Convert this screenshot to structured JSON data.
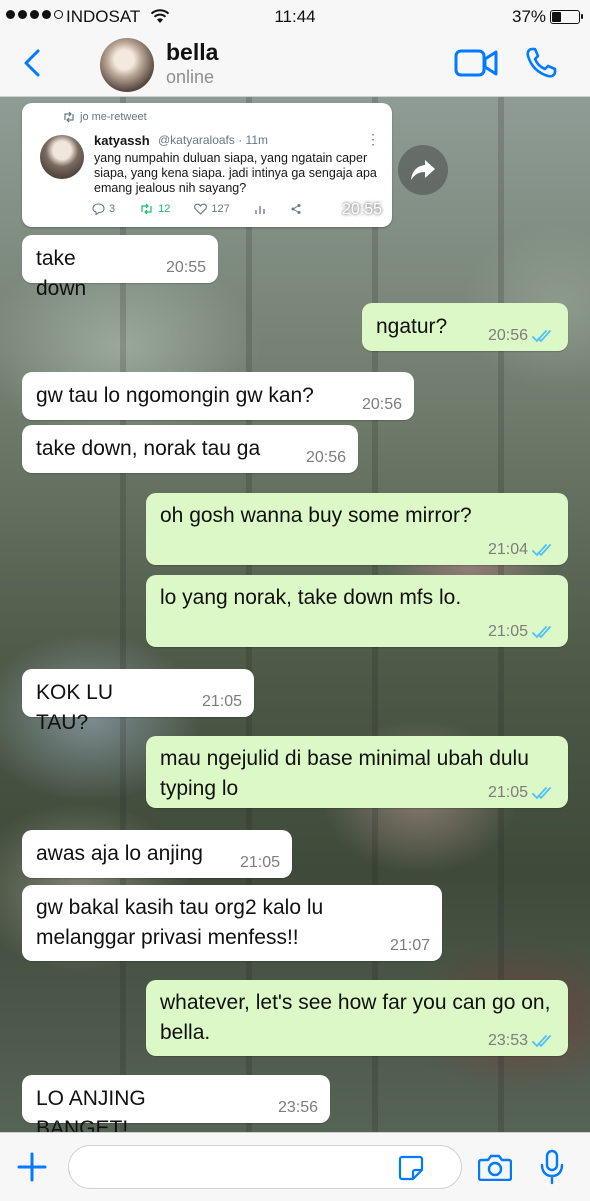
{
  "status_bar": {
    "carrier": "INDOSAT",
    "time": "11:44",
    "battery_pct": "37%",
    "battery_level": 0.37,
    "signal_bars": 4
  },
  "header": {
    "contact_name": "bella",
    "contact_status": "online"
  },
  "tweet": {
    "retweet_line": "jo me-retweet",
    "name": "katyassh",
    "handle": "@katyaraloafs · 11m",
    "body": "yang numpahin duluan siapa, yang ngatain caper siapa, yang kena siapa. jadi intinya ga sengaja apa emang jealous nih sayang?",
    "replies": "3",
    "retweets": "12",
    "likes": "127",
    "time": "20:55"
  },
  "messages": [
    {
      "dir": "in",
      "text": "take down",
      "time": "20:55"
    },
    {
      "dir": "out",
      "text": "ngatur?",
      "time": "20:56"
    },
    {
      "dir": "in",
      "text": "gw tau lo ngomongin gw kan?",
      "time": "20:56"
    },
    {
      "dir": "in",
      "text": "take down, norak tau ga",
      "time": "20:56"
    },
    {
      "dir": "out",
      "text": "oh gosh wanna buy some mirror?",
      "time": "21:04"
    },
    {
      "dir": "out",
      "text": "lo yang norak, take down mfs lo.",
      "time": "21:05"
    },
    {
      "dir": "in",
      "text": "KOK LU TAU?",
      "time": "21:05"
    },
    {
      "dir": "out",
      "text": "mau ngejulid di base minimal ubah dulu typing lo",
      "time": "21:05"
    },
    {
      "dir": "in",
      "text": "awas aja lo anjing",
      "time": "21:05"
    },
    {
      "dir": "in",
      "text": "gw bakal kasih tau org2 kalo lu melanggar privasi menfess!!",
      "time": "21:07"
    },
    {
      "dir": "out",
      "text": "whatever, let's see how far you can go on, bella.",
      "time": "23:53"
    },
    {
      "dir": "in",
      "text": "LO ANJING BANGET!",
      "time": "23:56"
    }
  ],
  "input": {
    "placeholder": "",
    "value": ""
  },
  "colors": {
    "accent": "#007aff",
    "outgoing_bubble": "#dcf8c6",
    "incoming_bubble": "#ffffff",
    "read_ticks": "#4fc3f7"
  },
  "icons": [
    "back-icon",
    "video-call-icon",
    "phone-call-icon",
    "forward-icon",
    "plus-icon",
    "sticker-icon",
    "camera-icon",
    "mic-icon"
  ]
}
